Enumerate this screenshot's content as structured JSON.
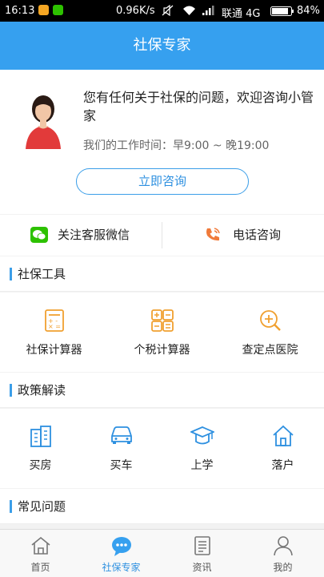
{
  "status_bar": {
    "time": "16:13",
    "network_speed": "0.96K/s",
    "carrier": "联通 4G",
    "battery": "84%"
  },
  "header": {
    "title": "社保专家"
  },
  "consult_card": {
    "welcome": "您有任何关于社保的问题，欢迎咨询小管家",
    "hours": "我们的工作时间：早9:00 ~ 晚19:00",
    "button_label": "立即咨询"
  },
  "contact": {
    "wechat_label": "关注客服微信",
    "phone_label": "电话咨询"
  },
  "tools_section": {
    "title": "社保工具",
    "items": [
      {
        "label": "社保计算器",
        "icon": "calculator-icon"
      },
      {
        "label": "个税计算器",
        "icon": "tax-calculator-icon"
      },
      {
        "label": "查定点医院",
        "icon": "hospital-search-icon"
      }
    ]
  },
  "policy_section": {
    "title": "政策解读",
    "items": [
      {
        "label": "买房",
        "icon": "building-icon"
      },
      {
        "label": "买车",
        "icon": "car-icon"
      },
      {
        "label": "上学",
        "icon": "graduation-cap-icon"
      },
      {
        "label": "落户",
        "icon": "house-icon"
      }
    ]
  },
  "faq_section": {
    "title": "常见问题"
  },
  "tab_bar": {
    "active_index": 1,
    "tabs": [
      {
        "label": "首页",
        "icon": "home-icon"
      },
      {
        "label": "社保专家",
        "icon": "chat-bubble-icon"
      },
      {
        "label": "资讯",
        "icon": "news-icon"
      },
      {
        "label": "我的",
        "icon": "person-icon"
      }
    ]
  },
  "colors": {
    "primary": "#36a0ef",
    "tool_accent": "#f0a030",
    "policy_accent": "#2e90e0",
    "wechat_green": "#2dc100",
    "phone_orange": "#f07a3a"
  }
}
